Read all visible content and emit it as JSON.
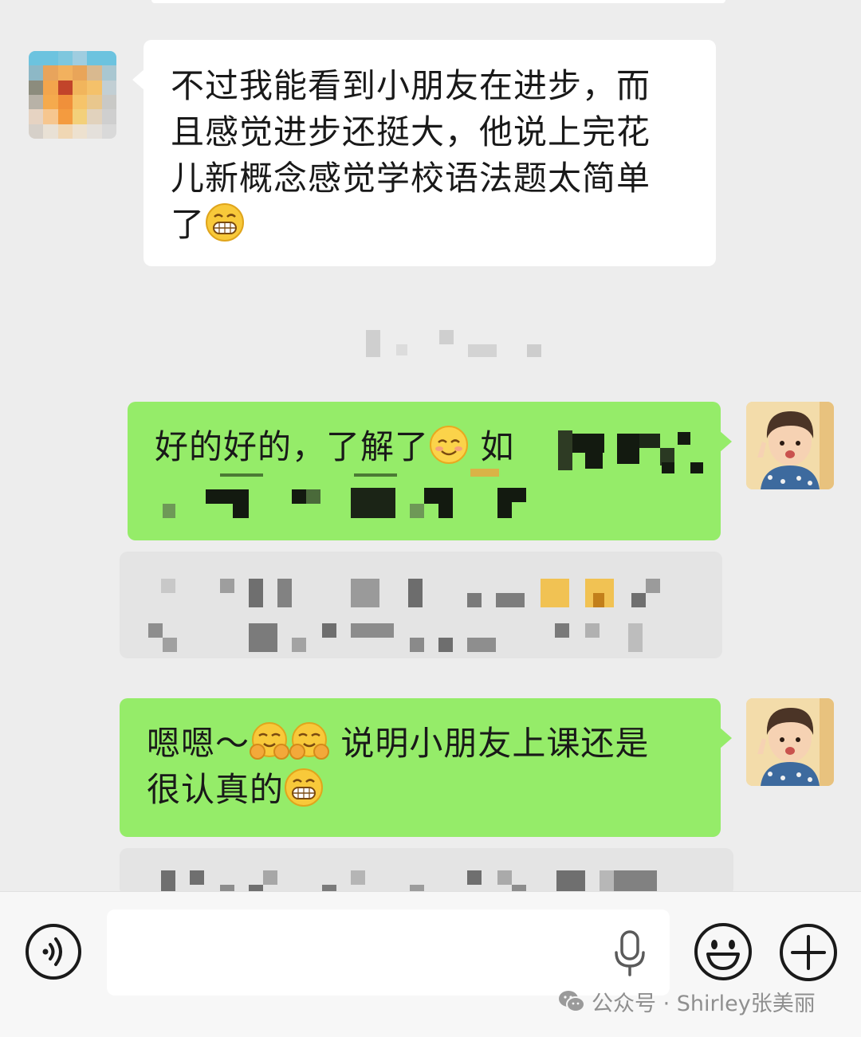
{
  "messages": [
    {
      "side": "left",
      "lines": [
        "不过我能看到小朋友在进步，而",
        "且感觉进步还挺大，他说上完花",
        "儿新概念感觉学校语法题太简单",
        "了"
      ],
      "emoji": "grinning-face-emoji"
    },
    {
      "side": "right",
      "line1_text": "好的好的，了解了",
      "line1_after": "如",
      "emoji": "smiling-face-emoji",
      "note": "remainder pixelated"
    },
    {
      "side": "right",
      "line1_before": "嗯嗯～",
      "line1_after": "说明小朋友上课还是",
      "line2_text": "很认真的",
      "emojis": [
        "hugging-face-emoji",
        "hugging-face-emoji",
        "grinning-face-emoji"
      ]
    }
  ],
  "input_bar": {
    "voice_icon": "voice-icon",
    "mic_icon": "mic-icon",
    "emoji_icon": "emoji-icon",
    "add_icon": "plus-icon"
  },
  "watermark": {
    "text": "公众号 · Shirley张美丽",
    "icon": "wechat-icon"
  },
  "colors": {
    "background": "#ededed",
    "incoming_bubble": "#ffffff",
    "outgoing_bubble": "#95ec69",
    "text": "#191919"
  }
}
